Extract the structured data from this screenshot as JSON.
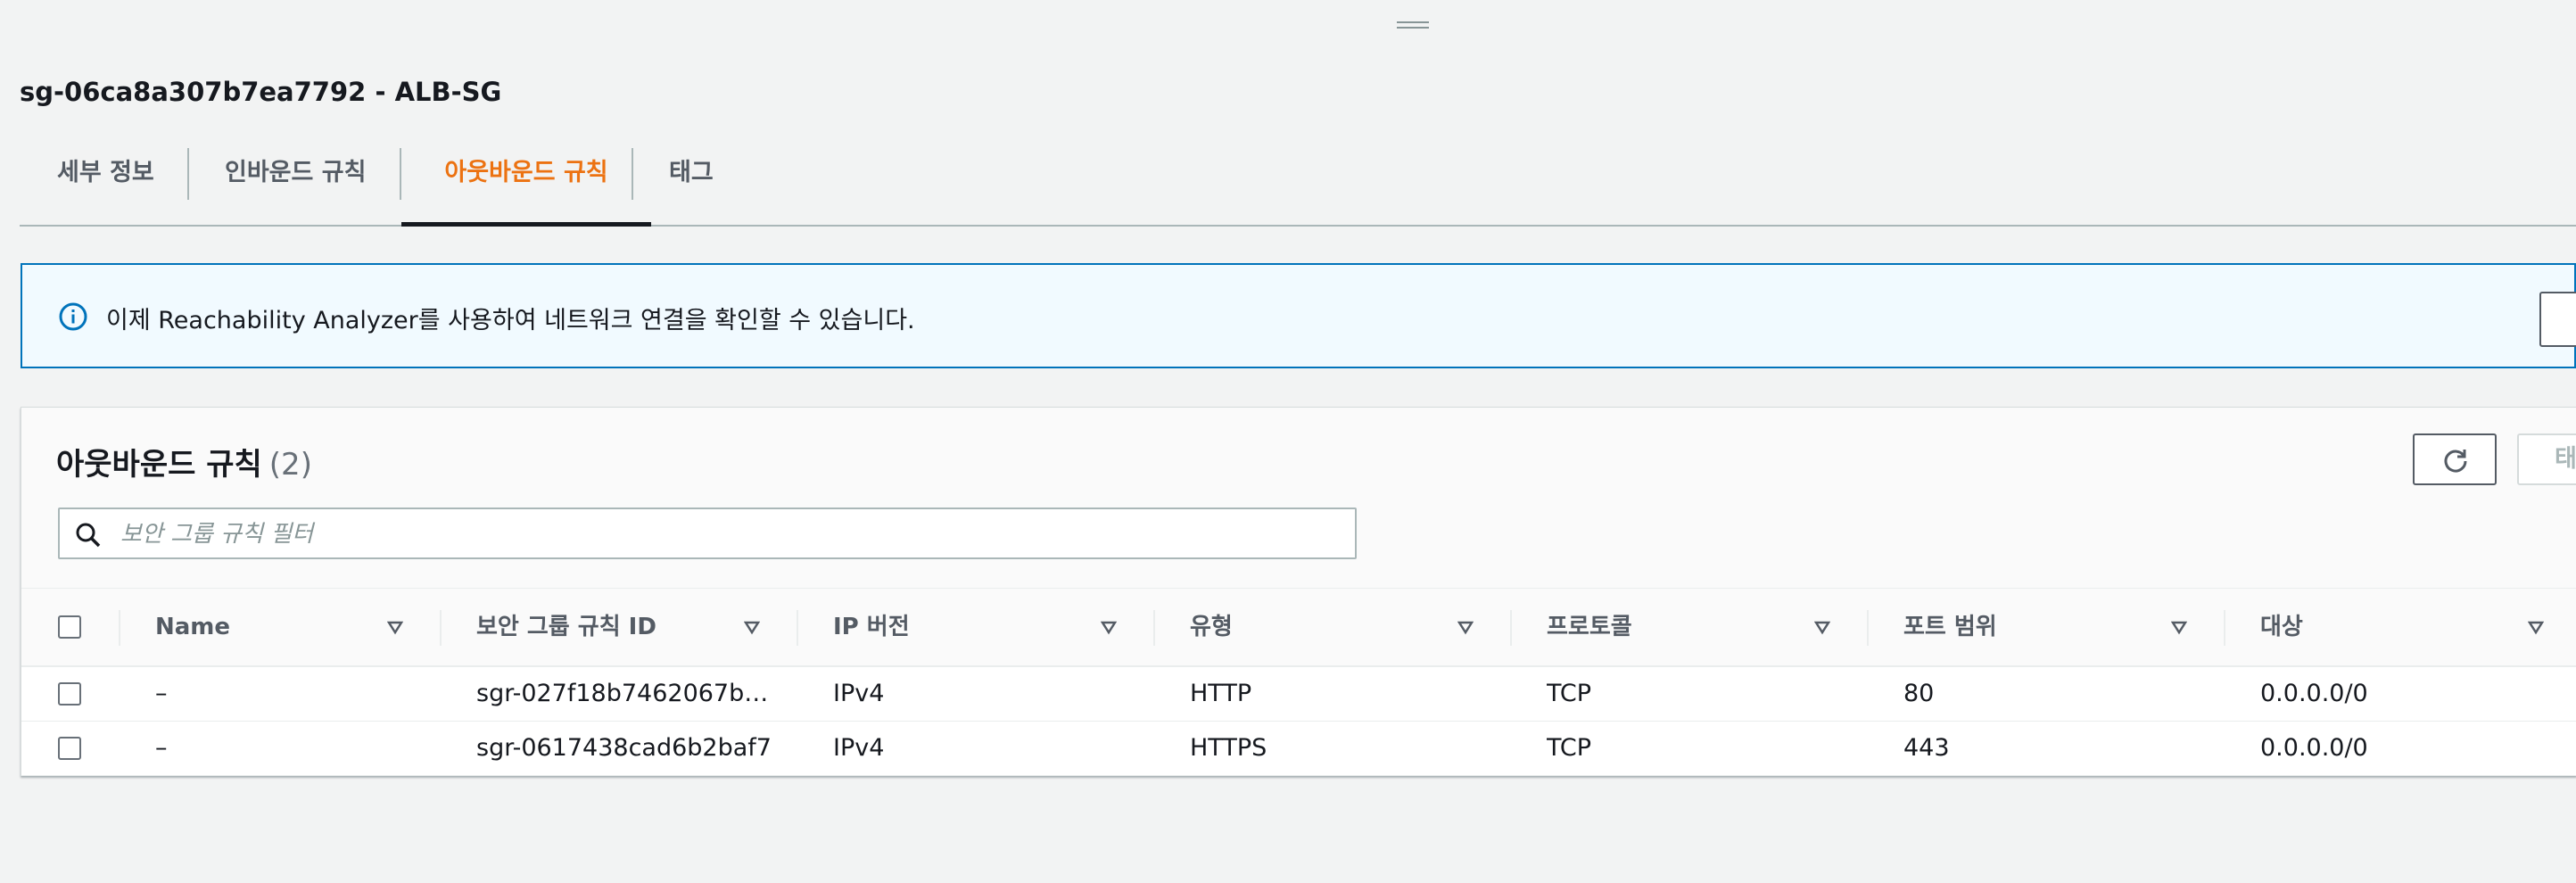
{
  "security_group": {
    "title": "sg-06ca8a307b7ea7792 - ALB-SG"
  },
  "tabs": [
    {
      "label": "세부 정보",
      "active": false
    },
    {
      "label": "인바운드 규칙",
      "active": false
    },
    {
      "label": "아웃바운드 규칙",
      "active": true
    },
    {
      "label": "태그",
      "active": false
    }
  ],
  "info_alert": {
    "text": "이제 Reachability Analyzer를 사용하여 네트워크 연결을 확인할 수 있습니다."
  },
  "rules_panel": {
    "title": "아웃바운드 규칙",
    "count": "(2)",
    "edit_button_label": "태",
    "filter": {
      "placeholder": "보안 그룹 규칙 필터",
      "value": ""
    },
    "columns": [
      "Name",
      "보안 그룹 규칙 ID",
      "IP 버전",
      "유형",
      "프로토콜",
      "포트 범위",
      "대상"
    ],
    "rows": [
      {
        "name": "–",
        "rule_id": "sgr-027f18b7462067b…",
        "ip_version": "IPv4",
        "type": "HTTP",
        "protocol": "TCP",
        "port_range": "80",
        "destination": "0.0.0.0/0"
      },
      {
        "name": "–",
        "rule_id": "sgr-0617438cad6b2baf7",
        "ip_version": "IPv4",
        "type": "HTTPS",
        "protocol": "TCP",
        "port_range": "443",
        "destination": "0.0.0.0/0"
      }
    ]
  },
  "colors": {
    "accent": "#ec7211",
    "info_border": "#0073bb",
    "info_background": "#f1faff",
    "page_background": "#f2f3f3"
  },
  "icons": {
    "drag_handle": "drag-handle-icon",
    "info": "info-icon",
    "refresh": "refresh-icon",
    "search": "search-icon",
    "sort": "sort-down-icon"
  }
}
